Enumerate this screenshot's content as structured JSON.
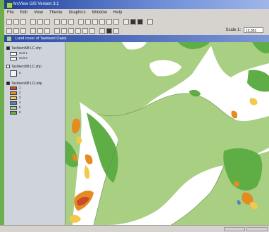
{
  "app": {
    "title": "ArcView GIS Version 3.1"
  },
  "menu": {
    "items": [
      "File",
      "Edit",
      "View",
      "Theme",
      "Graphics",
      "Window",
      "Help"
    ]
  },
  "toolbar": {
    "scale_label": "Scale 1:",
    "scale_value": "12,351"
  },
  "map_window": {
    "title": "Land cover of Tashkent Oasis"
  },
  "toc": {
    "layers": [
      {
        "name": "Tashkent98 LC.shp",
        "checked": true
      },
      {
        "name": "Tashkent98 LC.shp",
        "checked": false
      },
      {
        "name": "Tashkent98 LCi.shp",
        "checked": true
      }
    ],
    "legend1": [
      "Unit 1",
      "Unit 2"
    ],
    "legend2": [
      "0"
    ],
    "legend3": [
      "1",
      "2",
      "3",
      "4",
      "5",
      "6"
    ]
  },
  "colors": {
    "light_green": "#a9cf82",
    "dark_green": "#5fae45",
    "orange": "#e58b20",
    "yellow": "#f4c84a",
    "blue": "#4a86c6",
    "red": "#c84a2a"
  },
  "status": {
    "text": ""
  }
}
